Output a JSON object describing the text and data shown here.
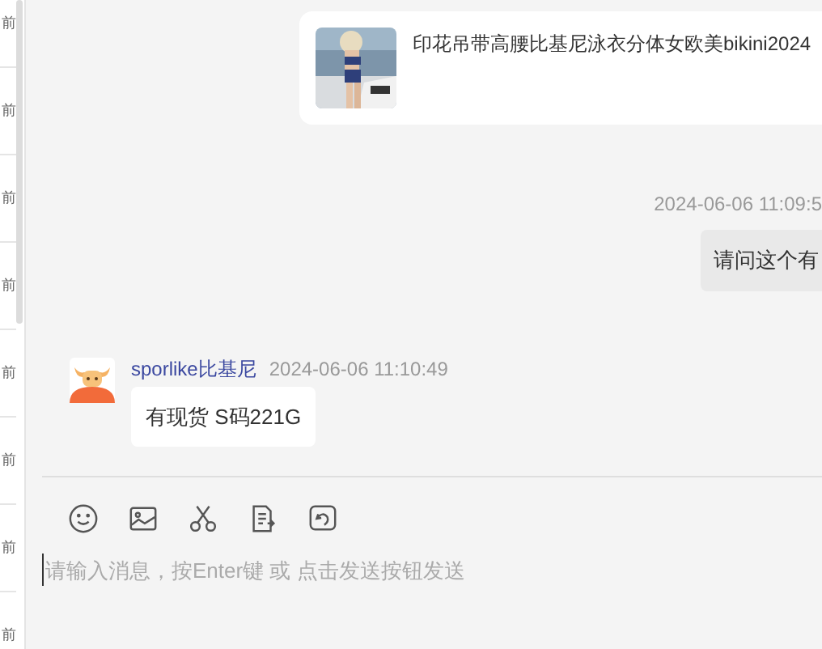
{
  "sidebar": {
    "items": [
      "前",
      "前",
      "前",
      "前",
      "前",
      "前",
      "前",
      "前"
    ]
  },
  "messages": [
    {
      "kind": "product",
      "title": "印花吊带高腰比基尼泳衣分体女欧美bikini2024"
    },
    {
      "kind": "time",
      "text": "2024-06-06 11:09:5"
    },
    {
      "kind": "outgoing",
      "text": "请问这个有"
    },
    {
      "kind": "incoming",
      "sender": "sporlike比基尼",
      "time": "2024-06-06 11:10:49",
      "text": "有现货 S码221G"
    }
  ],
  "composer": {
    "placeholder": "请输入消息，按Enter键 或 点击发送按钮发送"
  }
}
